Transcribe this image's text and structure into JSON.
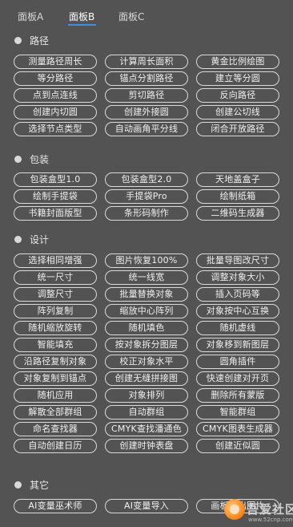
{
  "tabs": [
    {
      "label": "面板A"
    },
    {
      "label": "面板B"
    },
    {
      "label": "面板C"
    }
  ],
  "sections": [
    {
      "title": "路径",
      "buttons": [
        "测量路径周长",
        "计算周长面积",
        "黄金比例绘图",
        "等分路径",
        "锚点分割路径",
        "建立等分圆",
        "点到点连线",
        "剪切路径",
        "反向路径",
        "创建内切圆",
        "创建外接圆",
        "创建公切线",
        "选择节点类型",
        "自动画角平分线",
        "闭合开放路径"
      ]
    },
    {
      "title": "包装",
      "buttons": [
        "包装盒型1.0",
        "包装盒型2.0",
        "天地盖盒子",
        "绘制手提袋",
        "手提袋Pro",
        "绘制纸箱",
        "书籍封面版型",
        "条形码制作",
        "二维码生成器"
      ]
    },
    {
      "title": "设计",
      "buttons": [
        "选择相同增强",
        "图片恢复100%",
        "批量导图改尺寸",
        "统一尺寸",
        "统一线宽",
        "调整对象大小",
        "调整尺寸",
        "批量替换对象",
        "插入页码等",
        "阵列复制",
        "缩放中心阵列",
        "对象按中心互换",
        "随机缩放旋转",
        "随机填色",
        "随机虚线",
        "智能填充",
        "按对象拆分图层",
        "对象移到新图层",
        "沿路径复制对象",
        "校正对象水平",
        "圆角插件",
        "对象复制到锚点",
        "创建无缝拼接图",
        "快速创建对开页",
        "随机应用",
        "对象排列",
        "删除所有蒙版",
        "解散全部群组",
        "自动群组",
        "智能群组",
        "命名查找器",
        "CMYK查找潘通色",
        "CMYK图表生成器",
        "自动创建日历",
        "创建时钟表盘",
        "创建近似圆"
      ]
    },
    {
      "title": "其它",
      "buttons": [
        "AI变量巫术师",
        "AI变量导入",
        "画板导出图片"
      ]
    }
  ],
  "watermark": {
    "text": "吾爱社区",
    "sub": "www.52cnp.com"
  },
  "colors": {
    "background": "#535353",
    "tab_active_underline": "#3d8fe6",
    "button_border": "#dadada"
  }
}
